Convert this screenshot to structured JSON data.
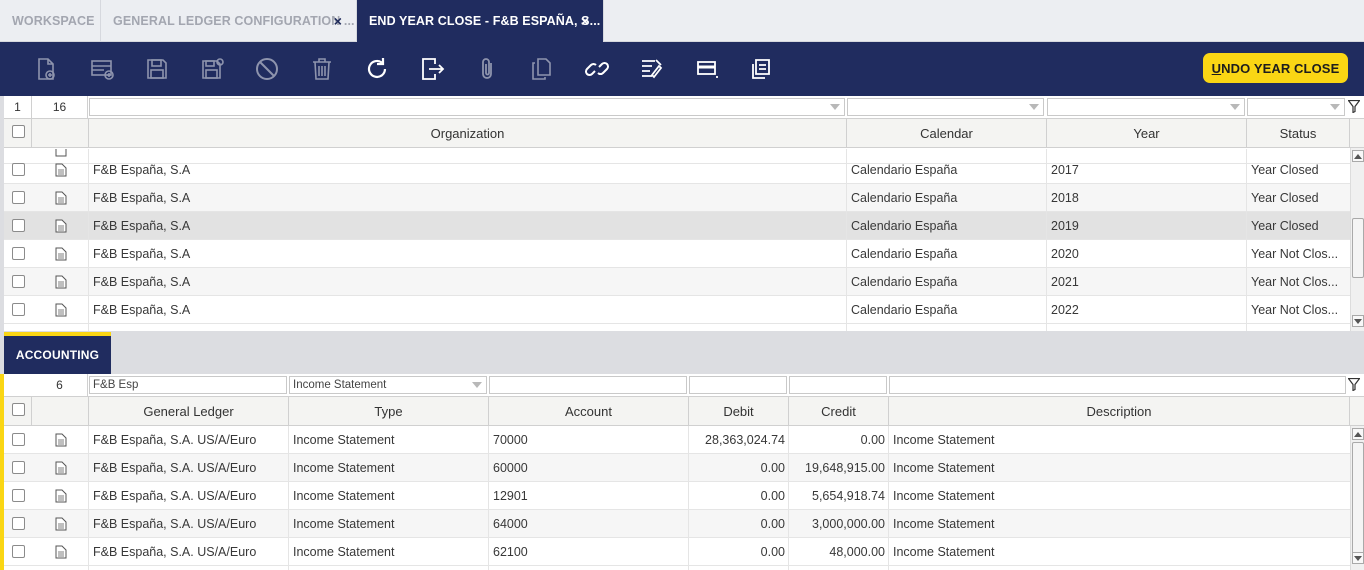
{
  "tabs": [
    {
      "label": "WORKSPACE",
      "closable": false,
      "active": false
    },
    {
      "label": "GENERAL LEDGER CONFIGURATION ...",
      "closable": true,
      "active": false
    },
    {
      "label": "END YEAR CLOSE - F&B ESPAÑA, S...",
      "closable": true,
      "active": true
    }
  ],
  "tab_close_glyph": "×",
  "toolbar": {
    "icons": [
      "new-document-icon",
      "new-row-icon",
      "save-icon",
      "save-close-icon",
      "cancel-icon",
      "delete-icon",
      "refresh-icon",
      "export-icon",
      "attach-icon",
      "copy-record-icon",
      "link-icon",
      "audit-trail-icon",
      "toggle-view-icon",
      "notes-icon"
    ],
    "undo_label_first": "U",
    "undo_label_rest": "NDO YEAR CLOSE"
  },
  "top_grid": {
    "selected_count": "1",
    "total_count": "16",
    "columns": [
      "Organization",
      "Calendar",
      "Year",
      "Status"
    ],
    "rows": [
      {
        "organization": "F&B España, S.A",
        "calendar": "Calendario España",
        "year": "2017",
        "status": "Year Closed",
        "selected": false
      },
      {
        "organization": "F&B España, S.A",
        "calendar": "Calendario España",
        "year": "2018",
        "status": "Year Closed",
        "selected": false
      },
      {
        "organization": "F&B España, S.A",
        "calendar": "Calendario España",
        "year": "2019",
        "status": "Year Closed",
        "selected": true
      },
      {
        "organization": "F&B España, S.A",
        "calendar": "Calendario España",
        "year": "2020",
        "status": "Year Not Clos...",
        "selected": false
      },
      {
        "organization": "F&B España, S.A",
        "calendar": "Calendario España",
        "year": "2021",
        "status": "Year Not Clos...",
        "selected": false
      },
      {
        "organization": "F&B España, S.A",
        "calendar": "Calendario España",
        "year": "2022",
        "status": "Year Not Clos...",
        "selected": false
      }
    ]
  },
  "accounting": {
    "tab_label": "ACCOUNTING",
    "count": "6",
    "filters": {
      "general_ledger": "F&B Esp",
      "type": "Income Statement"
    },
    "columns": [
      "General Ledger",
      "Type",
      "Account",
      "Debit",
      "Credit",
      "Description"
    ],
    "rows": [
      {
        "general_ledger": "F&B España, S.A. US/A/Euro",
        "type": "Income Statement",
        "account": "70000",
        "debit": "28,363,024.74",
        "credit": "0.00",
        "description": "Income Statement"
      },
      {
        "general_ledger": "F&B España, S.A. US/A/Euro",
        "type": "Income Statement",
        "account": "60000",
        "debit": "0.00",
        "credit": "19,648,915.00",
        "description": "Income Statement"
      },
      {
        "general_ledger": "F&B España, S.A. US/A/Euro",
        "type": "Income Statement",
        "account": "12901",
        "debit": "0.00",
        "credit": "5,654,918.74",
        "description": "Income Statement"
      },
      {
        "general_ledger": "F&B España, S.A. US/A/Euro",
        "type": "Income Statement",
        "account": "64000",
        "debit": "0.00",
        "credit": "3,000,000.00",
        "description": "Income Statement"
      },
      {
        "general_ledger": "F&B España, S.A. US/A/Euro",
        "type": "Income Statement",
        "account": "62100",
        "debit": "0.00",
        "credit": "48,000.00",
        "description": "Income Statement"
      }
    ]
  },
  "colors": {
    "navy": "#202c5f",
    "accent_yellow": "#fad614",
    "selected_row": "#e2e2e2"
  }
}
